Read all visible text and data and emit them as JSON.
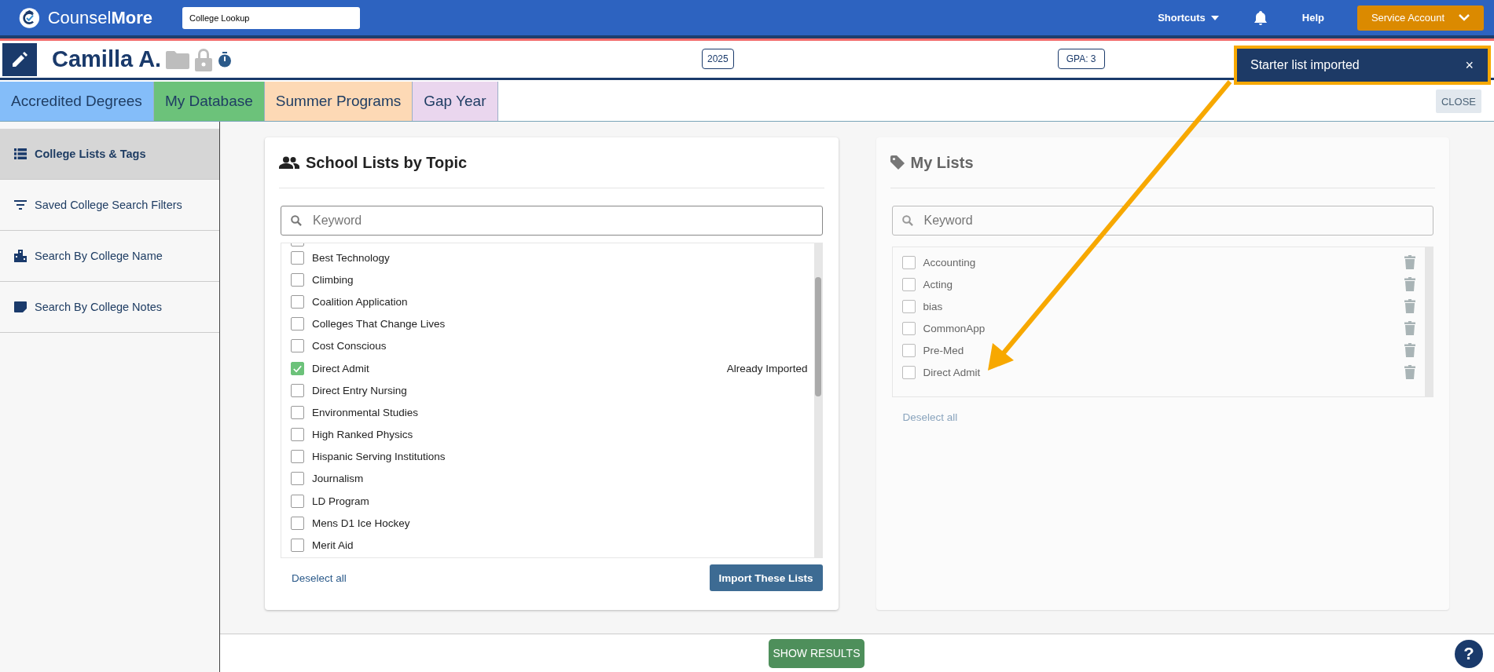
{
  "top_bar": {
    "logo": "Counsel**More**",
    "search": {
      "value": "College Lookup"
    },
    "shortcuts": "Shortcuts",
    "help": "Help",
    "account": "Service Account"
  },
  "student": {
    "name": "Camilla A.",
    "year": "2025",
    "gpa": "GPA: 3"
  },
  "toast": {
    "message": "Starter list imported",
    "close": "×"
  },
  "tabs": [
    {
      "label": "Accredited Degrees",
      "color": "#84bdf9"
    },
    {
      "label": "My Database",
      "color": "#6cc27a"
    },
    {
      "label": "Summer Programs",
      "color": "#fdd9b5"
    },
    {
      "label": "Gap Year",
      "color": "#ead6ee"
    }
  ],
  "close_button": "CLOSE",
  "sidebar": {
    "items": [
      {
        "kind": "list",
        "label": "College Lists & Tags",
        "selected": true
      },
      {
        "kind": "filter",
        "label": "Saved College Search Filters",
        "selected": false
      },
      {
        "kind": "building",
        "label": "Search By College Name",
        "selected": false
      },
      {
        "kind": "note",
        "label": "Search By College Notes",
        "selected": false
      }
    ]
  },
  "topic_lists": {
    "title": "School Lists by Topic",
    "search": {
      "placeholder": "Keyword"
    },
    "items": [
      {
        "label": "Best Technology",
        "checked": false
      },
      {
        "label": "Climbing",
        "checked": false
      },
      {
        "label": "Coalition Application",
        "checked": false
      },
      {
        "label": "Colleges That Change Lives",
        "checked": false
      },
      {
        "label": "Cost Conscious",
        "checked": false
      },
      {
        "label": "Direct Admit",
        "checked": true,
        "status": "Already Imported"
      },
      {
        "label": "Direct Entry Nursing",
        "checked": false
      },
      {
        "label": "Environmental Studies",
        "checked": false
      },
      {
        "label": "High Ranked Physics",
        "checked": false
      },
      {
        "label": "Hispanic Serving Institutions",
        "checked": false
      },
      {
        "label": "Journalism",
        "checked": false
      },
      {
        "label": "LD Program",
        "checked": false
      },
      {
        "label": "Mens D1 Ice Hockey",
        "checked": false
      },
      {
        "label": "Merit Aid",
        "checked": false
      }
    ],
    "deselect": "Deselect all",
    "import_button": "Import These Lists"
  },
  "my_lists": {
    "title": "My Lists",
    "search": {
      "placeholder": "Keyword"
    },
    "items": [
      {
        "label": "Accounting",
        "checked": false
      },
      {
        "label": "Acting",
        "checked": false
      },
      {
        "label": "bias",
        "checked": false
      },
      {
        "label": "CommonApp",
        "checked": false
      },
      {
        "label": "Pre-Med",
        "checked": false
      },
      {
        "label": "Direct Admit",
        "checked": false
      }
    ],
    "deselect": "Deselect all"
  },
  "show_results": "SHOW RESULTS",
  "help_button": "?"
}
